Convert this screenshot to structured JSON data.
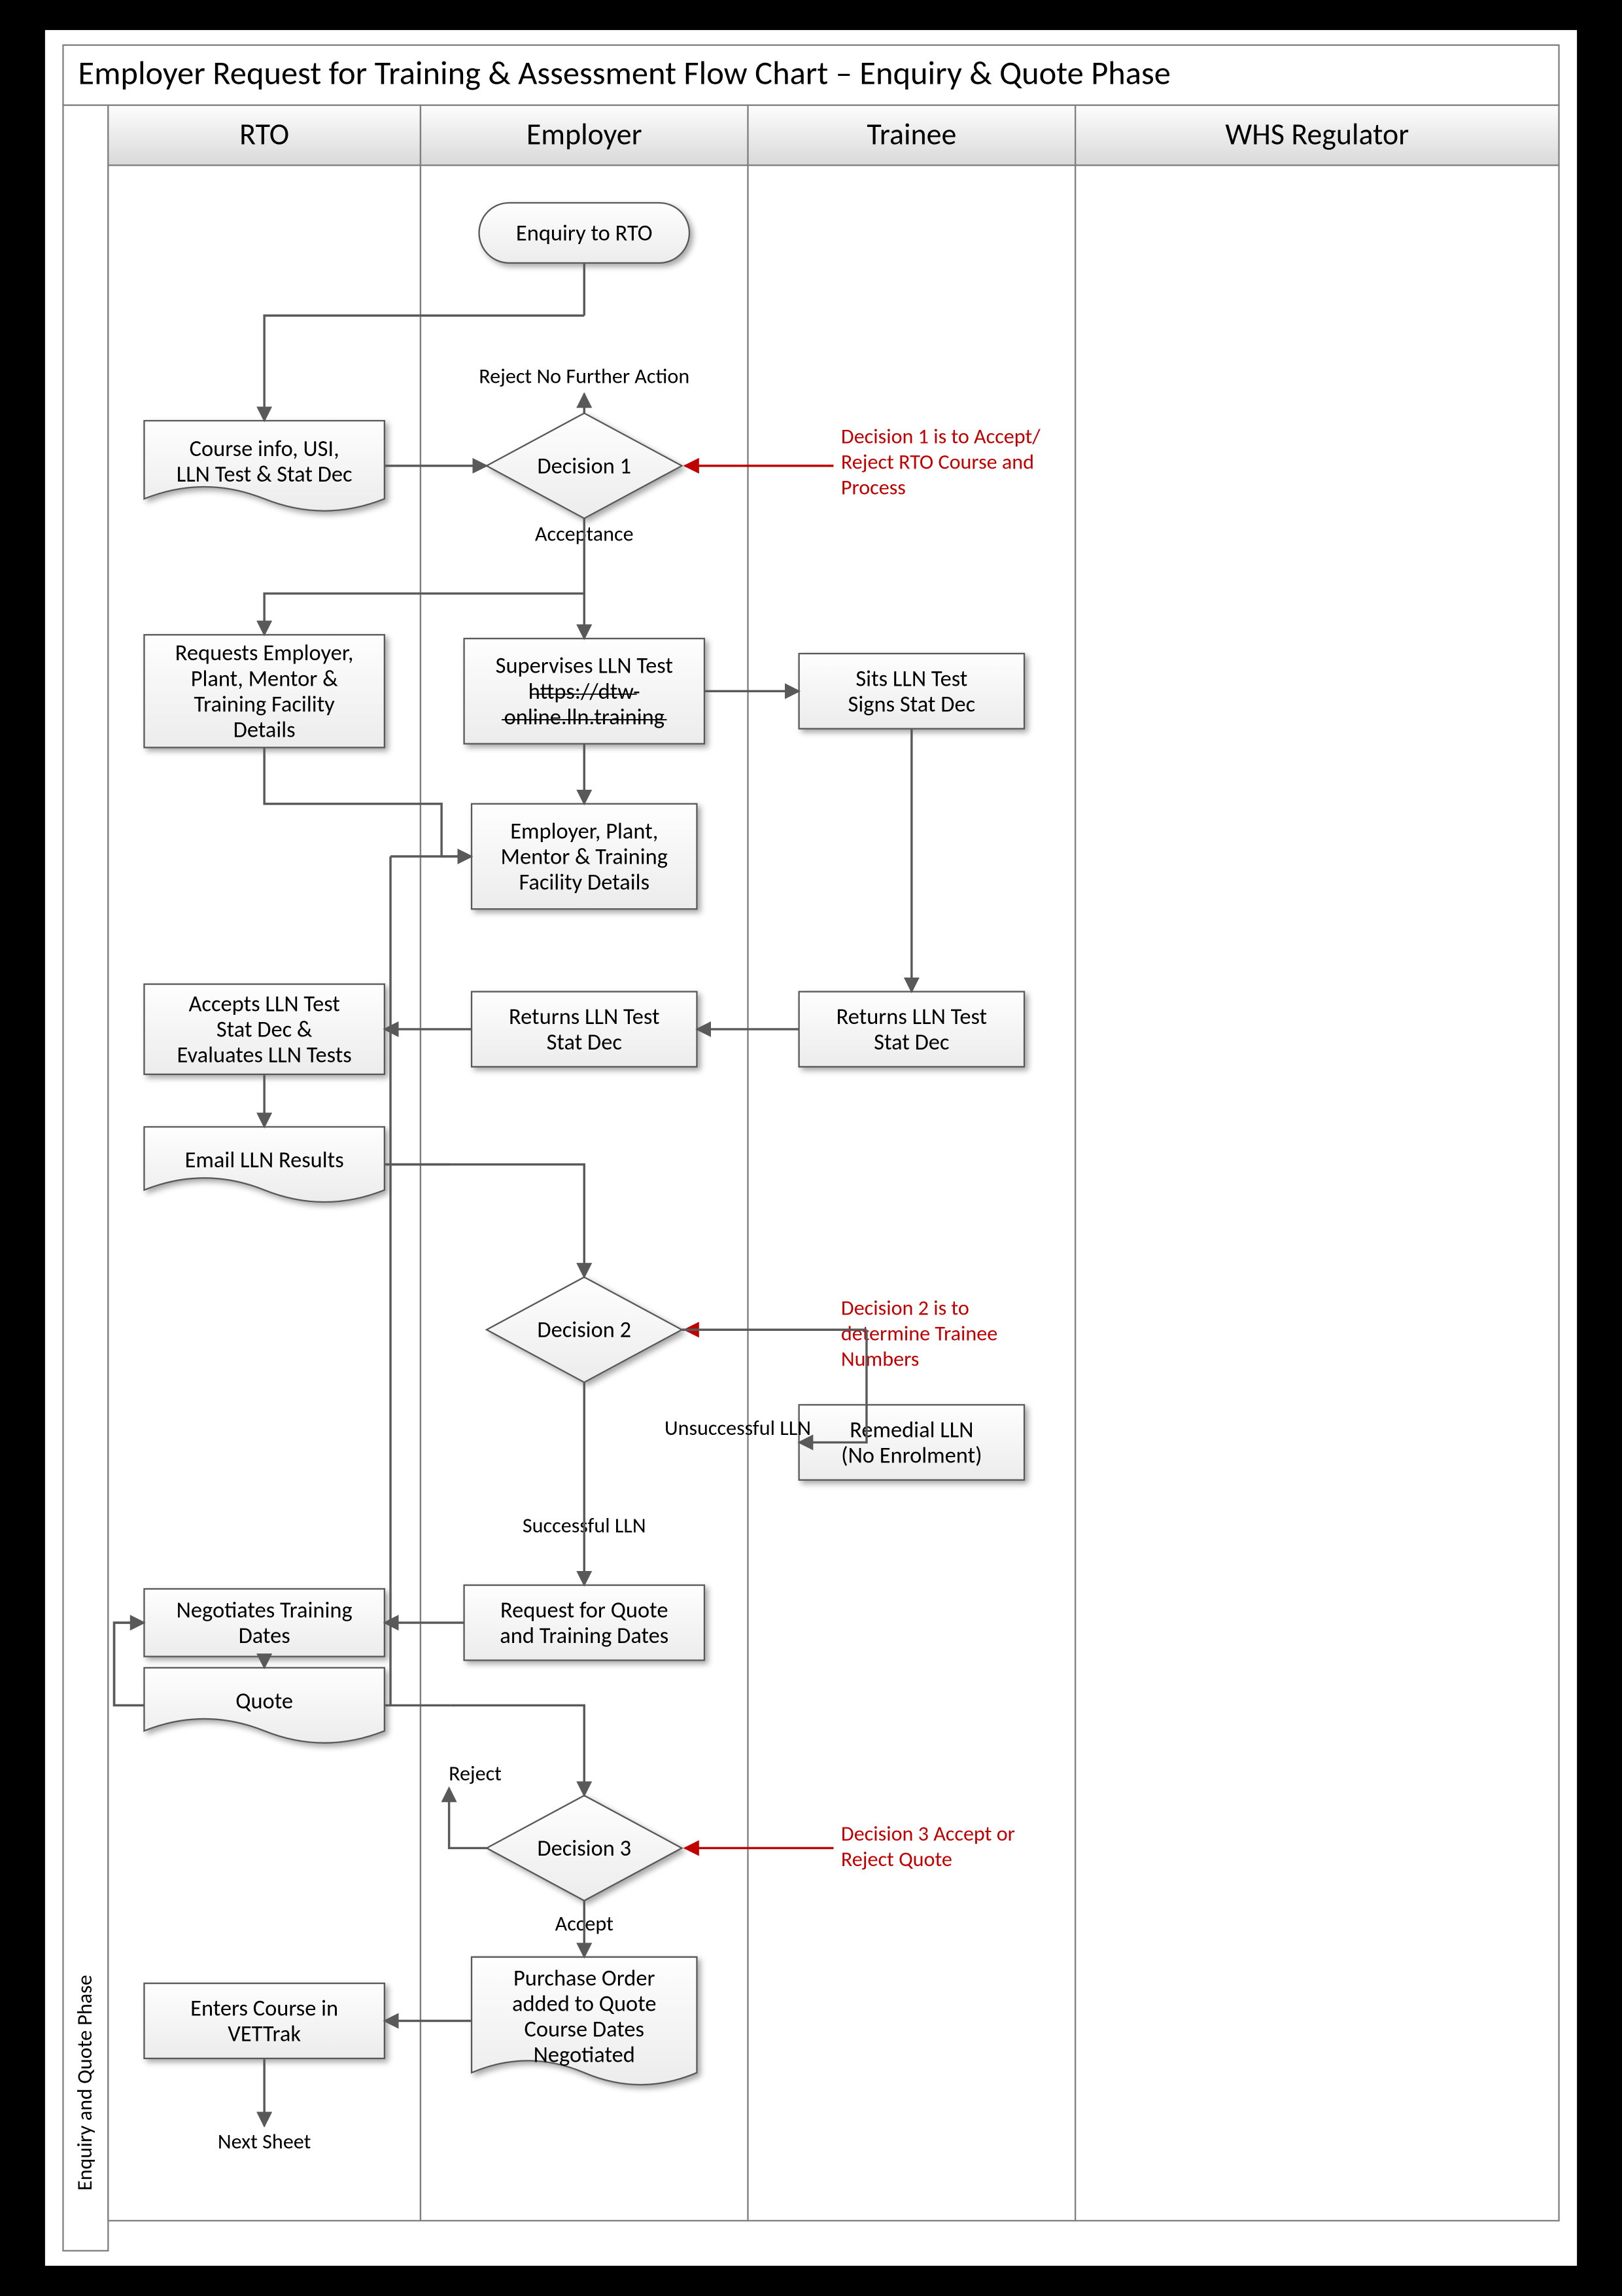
{
  "title": "Employer Request for Training & Assessment Flow Chart – Enquiry & Quote Phase",
  "sideLabel": "Enquiry and Quote Phase",
  "lanes": {
    "rto": "RTO",
    "employer": "Employer",
    "trainee": "Trainee",
    "whs": "WHS Regulator"
  },
  "start": {
    "label": "Enquiry to RTO"
  },
  "rtoBoxes": {
    "courseInfo": "Course info, USI, LLN Test & Stat Dec",
    "requestsDetails": "Requests Employer, Plant, Mentor & Training Facility Details",
    "acceptsLLN": "Accepts LLN Test Stat Dec & Evaluates LLN Tests",
    "emailResults": "Email LLN Results",
    "negotiates": "Negotiates Training Dates",
    "quote": "Quote",
    "entersCourse": "Enters Course in VETTrak",
    "nextSheet": "Next Sheet"
  },
  "employerBoxes": {
    "supervises1": "Supervises LLN Test",
    "supervises2": "https://dtw-online.lln.training",
    "plantDetails": "Employer, Plant, Mentor & Training Facility Details",
    "returnsLLN": "Returns LLN Test Stat Dec",
    "requestQuote": "Request for Quote and Training Dates",
    "purchaseOrder": "Purchase Order added to Quote Course Dates Negotiated"
  },
  "traineeBoxes": {
    "sitsLLN": "Sits LLN Test Signs Stat Dec",
    "returnsLLN": "Returns LLN Test Stat Dec",
    "remedial": "Remedial LLN (No Enrolment)"
  },
  "decisions": {
    "d1": "Decision 1",
    "d2": "Decision 2",
    "d3": "Decision 3"
  },
  "labels": {
    "rejectNoAction": "Reject No Further Action",
    "acceptance": "Acceptance",
    "unsuccessful": "Unsuccessful LLN",
    "successful": "Successful LLN",
    "reject": "Reject",
    "accept": "Accept"
  },
  "annotations": {
    "d1note": "Decision 1 is to Accept/ Reject RTO Course and Process",
    "d2note": "Decision 2 is to determine Trainee Numbers",
    "d3note": "Decision 3 Accept or Reject Quote"
  }
}
